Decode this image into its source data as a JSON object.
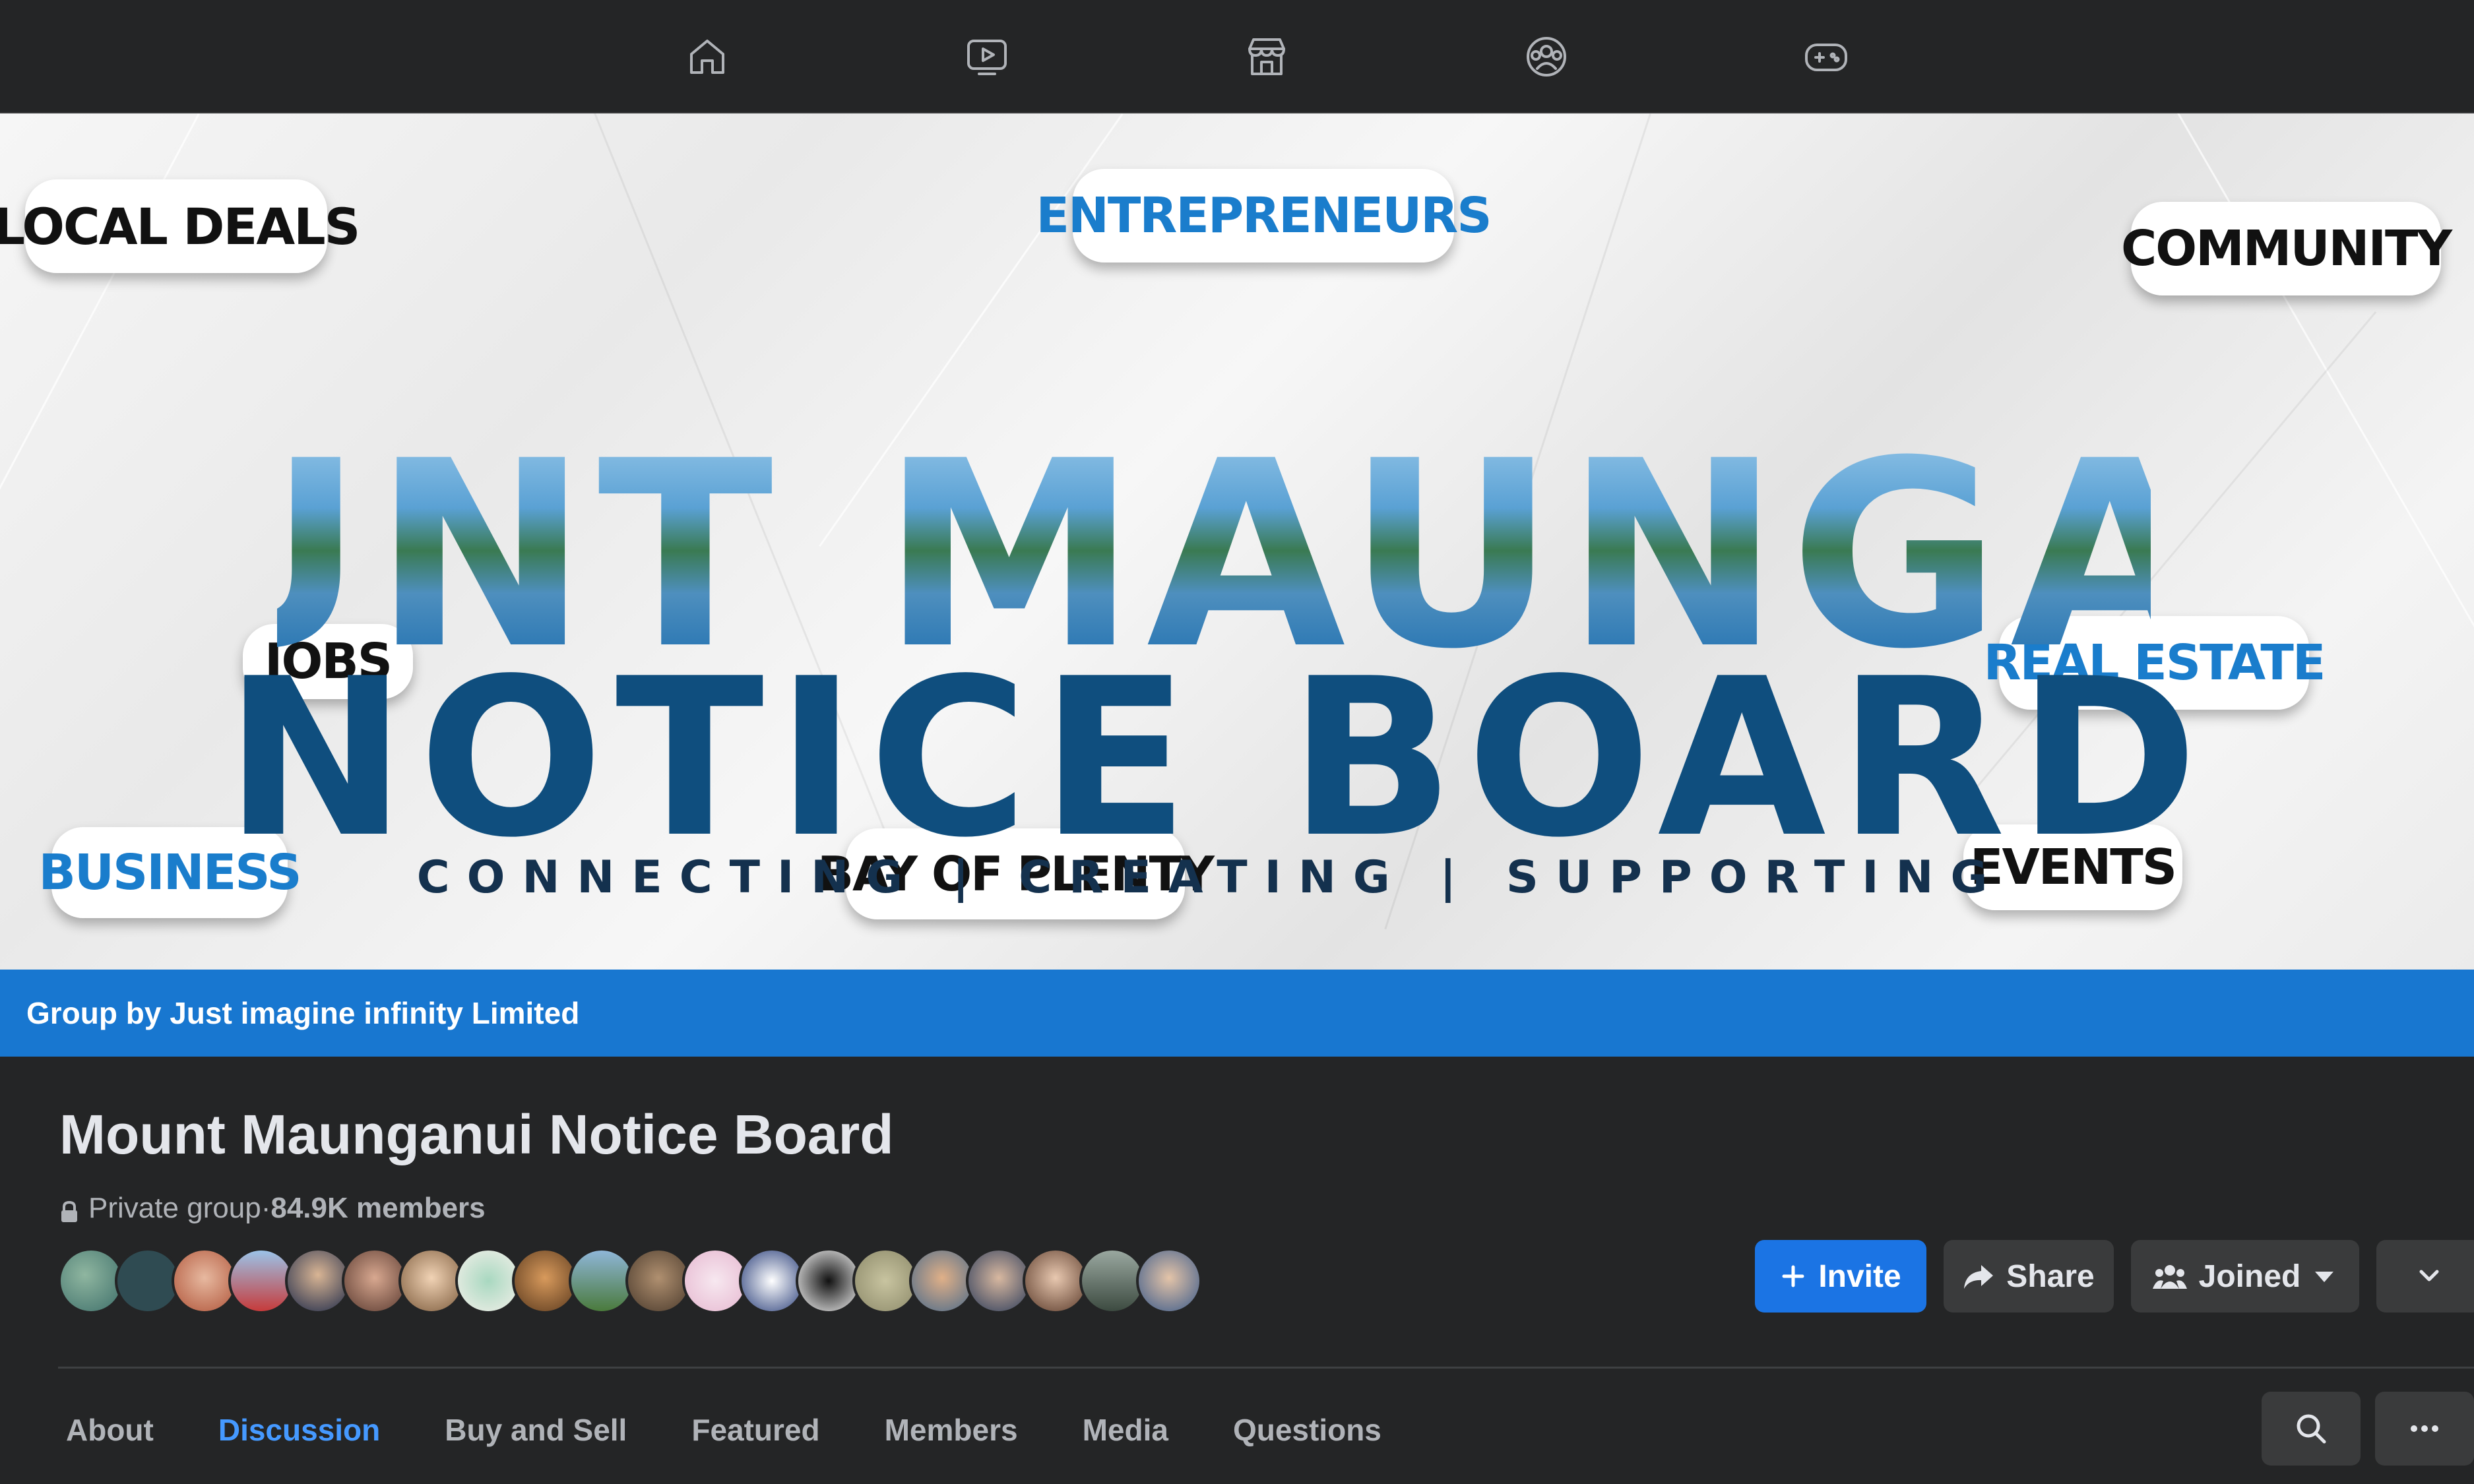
{
  "nav": {
    "icons": [
      "home-icon",
      "video-icon",
      "marketplace-icon",
      "groups-icon",
      "gaming-icon"
    ]
  },
  "cover": {
    "tags": {
      "local_deals": "LOCAL DEALS",
      "entrepreneurs": "ENTREPRENEURS",
      "community": "COMMUNITY",
      "jobs": "JOBS",
      "real_estate": "REAL ESTATE",
      "business": "BUSINESS",
      "bay_of_plenty": "BAY OF PLENTY",
      "events": "EVENTS"
    },
    "title_line1": "MOUNT MAUNGANUI",
    "title_line2": "NOTICE BOARD",
    "tagline": "CONNECTING | CREATING | SUPPORTING",
    "colors": {
      "tag_black": "#111111",
      "tag_blue": "#1a7dcc",
      "title_blue": "#0f4e7e"
    }
  },
  "owner_bar": {
    "text": "Group by Just imagine infinity Limited",
    "color": "#1877d0"
  },
  "group": {
    "name": "Mount Maunganui Notice Board",
    "privacy": "Private group",
    "separator": " · ",
    "members": "84.9K members",
    "member_avatar_count": 20
  },
  "actions": {
    "invite": "Invite",
    "share": "Share",
    "joined": "Joined",
    "accent": "#1b74e4"
  },
  "tabs": [
    "About",
    "Discussion",
    "Buy and Sell",
    "Featured",
    "Members",
    "Media",
    "Questions"
  ],
  "active_tab": "Discussion"
}
